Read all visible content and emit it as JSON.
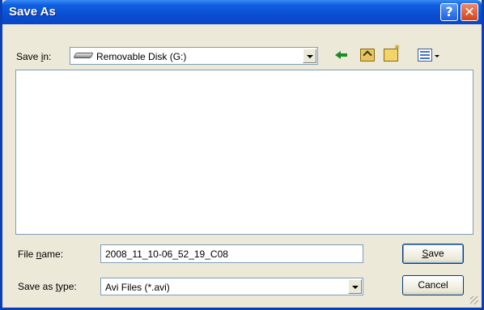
{
  "window": {
    "title": "Save As",
    "help_label": "?",
    "close_label": "✕"
  },
  "location": {
    "label_pre": "Save ",
    "label_accel": "i",
    "label_post": "n:",
    "value": "Removable Disk (G:)"
  },
  "toolbar": {
    "icons": [
      "back-icon",
      "up-folder-icon",
      "new-folder-icon",
      "views-menu-icon"
    ]
  },
  "file_name": {
    "label_pre": "File ",
    "label_accel": "n",
    "label_post": "ame:",
    "value": "2008_11_10-06_52_19_C08"
  },
  "file_type": {
    "label_pre": "Save as ",
    "label_accel": "t",
    "label_post": "ype:",
    "value": "Avi Files (*.avi)"
  },
  "buttons": {
    "save_accel": "S",
    "save_rest": "ave",
    "cancel": "Cancel"
  }
}
